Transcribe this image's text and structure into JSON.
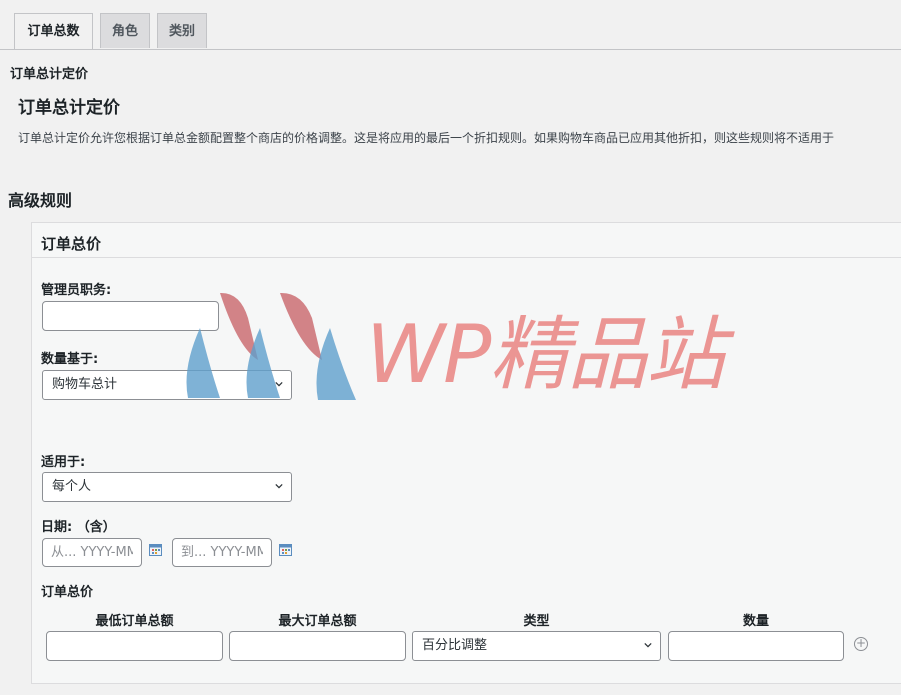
{
  "tabs": [
    {
      "label": "订单总数",
      "active": true
    },
    {
      "label": "角色",
      "active": false
    },
    {
      "label": "类别",
      "active": false
    }
  ],
  "section": {
    "breadcrumb": "订单总计定价",
    "title": "订单总计定价",
    "description": "订单总计定价允许您根据订单总金额配置整个商店的价格调整。这是将应用的最后一个折扣规则。如果购物车商品已应用其他折扣，则这些规则将不适用于"
  },
  "advanced": {
    "heading": "高级规则",
    "panel_title": "订单总价",
    "admin_role_label": "管理员职务:",
    "admin_role_value": "",
    "quantity_based_label": "数量基于:",
    "quantity_based_value": "购物车总计",
    "applies_to_label": "适用于:",
    "applies_to_value": "每个人",
    "date_label": "日期: （含）",
    "date_from_placeholder": "从... YYYY-MM-DD",
    "date_to_placeholder": "到... YYYY-MM-DD",
    "order_total_label": "订单总价",
    "columns": [
      "最低订单总额",
      "最大订单总额",
      "类型",
      "数量"
    ],
    "row": {
      "min": "",
      "max": "",
      "type": "百分比调整",
      "amount": ""
    }
  },
  "watermark": {
    "text": "WP精品站"
  },
  "colors": {
    "wm_red": "#c9656a",
    "wm_blue": "#5f9fcc"
  },
  "icons": [
    "chevron-down-icon",
    "calendar-icon",
    "add-row-icon"
  ]
}
